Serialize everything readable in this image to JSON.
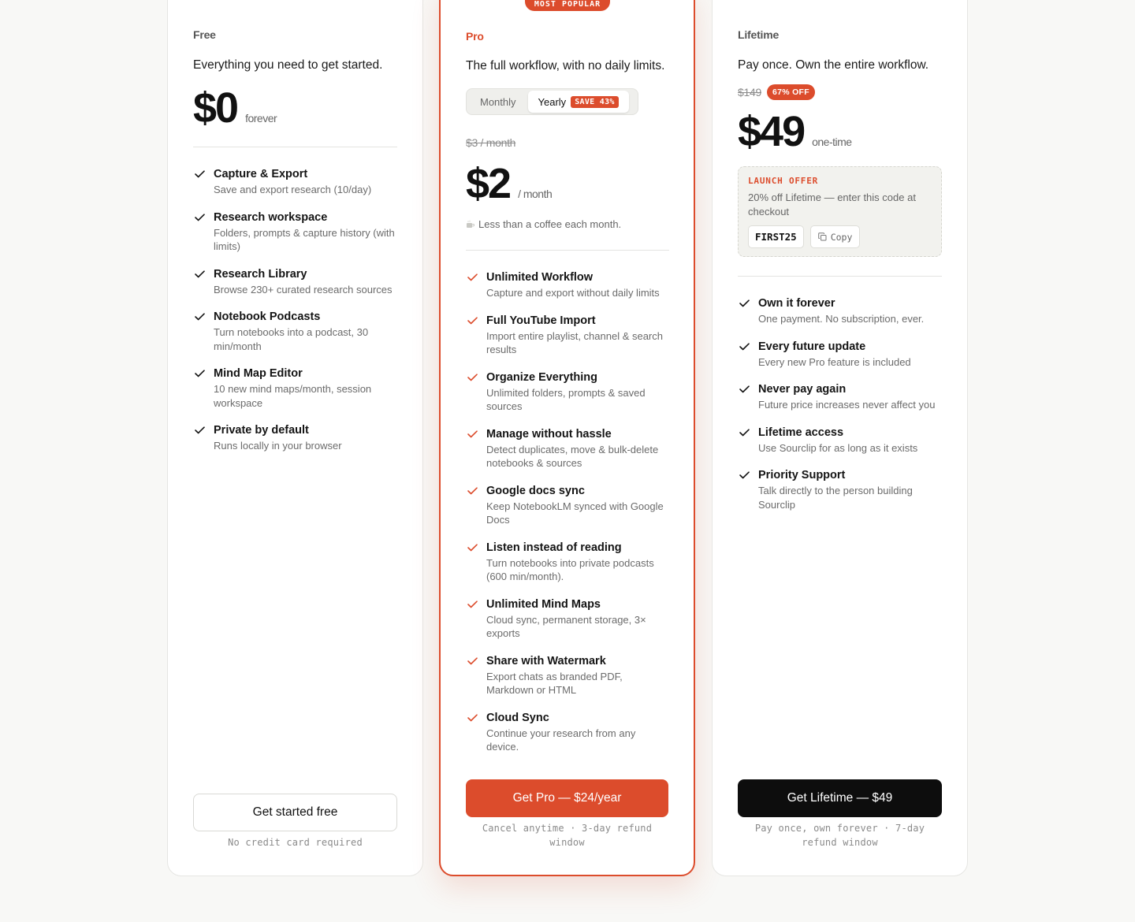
{
  "colors": {
    "accent": "#dc4c2c",
    "dark": "#0d0d0d",
    "muted": "#6b6b6b"
  },
  "free": {
    "name": "Free",
    "tagline": "Everything you need to get started.",
    "price": "$0",
    "price_suffix": "forever",
    "features": [
      {
        "title": "Capture & Export",
        "desc": "Save and export research (10/day)"
      },
      {
        "title": "Research workspace",
        "desc": "Folders, prompts & capture history (with limits)"
      },
      {
        "title": "Research Library",
        "desc": "Browse 230+ curated research sources"
      },
      {
        "title": "Notebook Podcasts",
        "desc": "Turn notebooks into a podcast, 30 min/month"
      },
      {
        "title": "Mind Map Editor",
        "desc": "10 new mind maps/month, session workspace"
      },
      {
        "title": "Private by default",
        "desc": "Runs locally in your browser"
      }
    ],
    "cta": "Get started free",
    "note": "No credit card required"
  },
  "pro": {
    "badge": "MOST POPULAR",
    "name": "Pro",
    "tagline": "The full workflow, with no daily limits.",
    "toggle": {
      "monthly": "Monthly",
      "yearly": "Yearly",
      "save": "SAVE 43%",
      "selected": "Yearly"
    },
    "old_price": "$3 / month",
    "price": "$2",
    "price_suffix": "/ month",
    "coffee_icon": "coffee-icon",
    "coffee_note": "Less than a coffee each month.",
    "features": [
      {
        "title": "Unlimited Workflow",
        "desc": "Capture and export without daily limits"
      },
      {
        "title": "Full YouTube Import",
        "desc": "Import entire playlist, channel & search results"
      },
      {
        "title": "Organize Everything",
        "desc": "Unlimited folders, prompts & saved sources"
      },
      {
        "title": "Manage without hassle",
        "desc": "Detect duplicates, move & bulk-delete notebooks & sources"
      },
      {
        "title": "Google docs sync",
        "desc": "Keep NotebookLM synced with Google Docs"
      },
      {
        "title": "Listen instead of reading",
        "desc": "Turn notebooks into private podcasts (600 min/month)."
      },
      {
        "title": "Unlimited Mind Maps",
        "desc": "Cloud sync, permanent storage, 3× exports"
      },
      {
        "title": "Share with Watermark",
        "desc": "Export chats as branded PDF, Markdown or HTML"
      },
      {
        "title": "Cloud Sync",
        "desc": "Continue your research from any device."
      }
    ],
    "cta": "Get Pro — $24/year",
    "note": "Cancel anytime · 3-day refund window"
  },
  "lifetime": {
    "name": "Lifetime",
    "tagline": "Pay once. Own the entire workflow.",
    "old_price": "$149",
    "discount": "67% OFF",
    "price": "$49",
    "price_suffix": "one-time",
    "offer": {
      "label": "LAUNCH OFFER",
      "text": "20% off Lifetime — enter this code at checkout",
      "code": "FIRST25",
      "copy": "Copy"
    },
    "features": [
      {
        "title": "Own it forever",
        "desc": "One payment. No subscription, ever."
      },
      {
        "title": "Every future update",
        "desc": "Every new Pro feature is included"
      },
      {
        "title": "Never pay again",
        "desc": "Future price increases never affect you"
      },
      {
        "title": "Lifetime access",
        "desc": "Use Sourclip for as long as it exists"
      },
      {
        "title": "Priority Support",
        "desc": "Talk directly to the person building Sourclip"
      }
    ],
    "cta": "Get Lifetime — $49",
    "note": "Pay once, own forever · 7-day refund window"
  }
}
